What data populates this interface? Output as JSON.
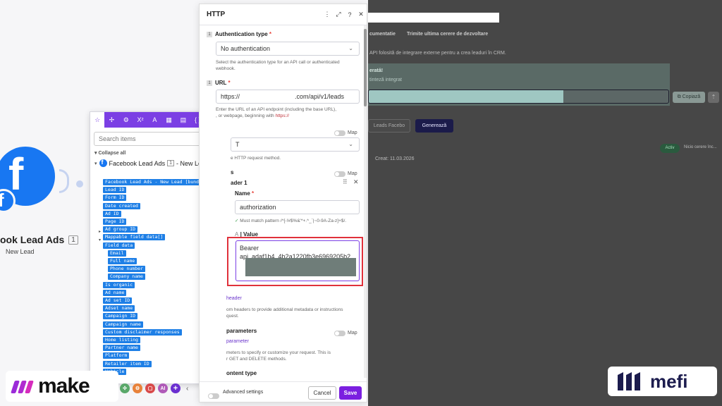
{
  "canvas": {
    "node_title": "ook Lead Ads",
    "node_badge": "1",
    "node_subtitle": "New Lead"
  },
  "picker": {
    "search_placeholder": "Search items",
    "collapse_all": "Collapse all",
    "module_name": "Facebook Lead Ads",
    "module_badge": "1",
    "module_event": "- New Lead",
    "items": [
      "Facebook Lead Ads - New Lead [bundle]",
      "Lead ID",
      "Form ID",
      "Date created",
      "Ad ID",
      "Page ID",
      "Ad group ID",
      "Mappable field data[]",
      "Field data",
      "Email",
      "Full name",
      "Phone number",
      "Company name",
      "Is organic",
      "Ad name",
      "Ad set ID",
      "Adset name",
      "Campaign ID",
      "Campaign name",
      "Custom disclaimer responses",
      "Home listing",
      "Partner name",
      "Platform",
      "Retailer item ID",
      "Vehicle"
    ]
  },
  "dock": {
    "brand": "make",
    "ai_label": "AI"
  },
  "http": {
    "title": "HTTP",
    "auth_label": "Authentication type",
    "auth_value": "No authentication",
    "auth_help": "Select the authentication type for an API call or authenticated webhook.",
    "url_label": "URL",
    "url_prefix": "https://",
    "url_suffix": ".com/api/v1/leads",
    "url_help_1": "Enter the URL of an API endpoint (including the base URL),",
    "url_help_2": ", or webpage, beginning with",
    "url_help_link": "https://",
    "map_label": "Map",
    "method_value": "T",
    "method_help": "e HTTP request method.",
    "headers_label": "s",
    "header_item": "ader 1",
    "name_label": "Name",
    "name_value": "authorization",
    "pattern_help": "Must match pattern /^[-!#$%&'*+.^_`|~0-9A-Za-z]+$/.",
    "value_label": "Value",
    "value_line1": "Bearer",
    "value_line2": "api_adaf1b4_4b2a1220fb3e6969205b2",
    "add_header": "header",
    "headers_help_1": "om headers to provide additional metadata or instructions",
    "headers_help_2": "quest.",
    "query_label": "parameters",
    "add_param": "parameter",
    "query_help_1": "meters to specify or customize your request. This is",
    "query_help_2": "r GET and DELETE methods.",
    "content_type_label": "ontent type",
    "advanced_label": "Advanced settings",
    "cancel": "Cancel",
    "save": "Save"
  },
  "right_app": {
    "tab_1": "cumentatie",
    "tab_2": "Trimite ultima cerere de dezvoltare",
    "desc": "API folosită de integrare externe pentru a crea leaduri în CRM.",
    "generated_title": "erată!",
    "generated_sub": "tinteză integrat",
    "copy_btn": "Copiază",
    "outline_btn": "Leads Facebo",
    "primary_btn": "Generează",
    "created": "Creat: 11.03.2026",
    "status": "Activ",
    "status_note": "Nicio cerere înc..."
  },
  "mefi": {
    "brand": "mefi"
  },
  "colors": {
    "make_purple": "#7b3fe4",
    "chip_blue": "#1e7fe6",
    "facebook_blue": "#1877f2",
    "save_purple": "#7b1fe0",
    "highlight_red": "#e0313b"
  }
}
